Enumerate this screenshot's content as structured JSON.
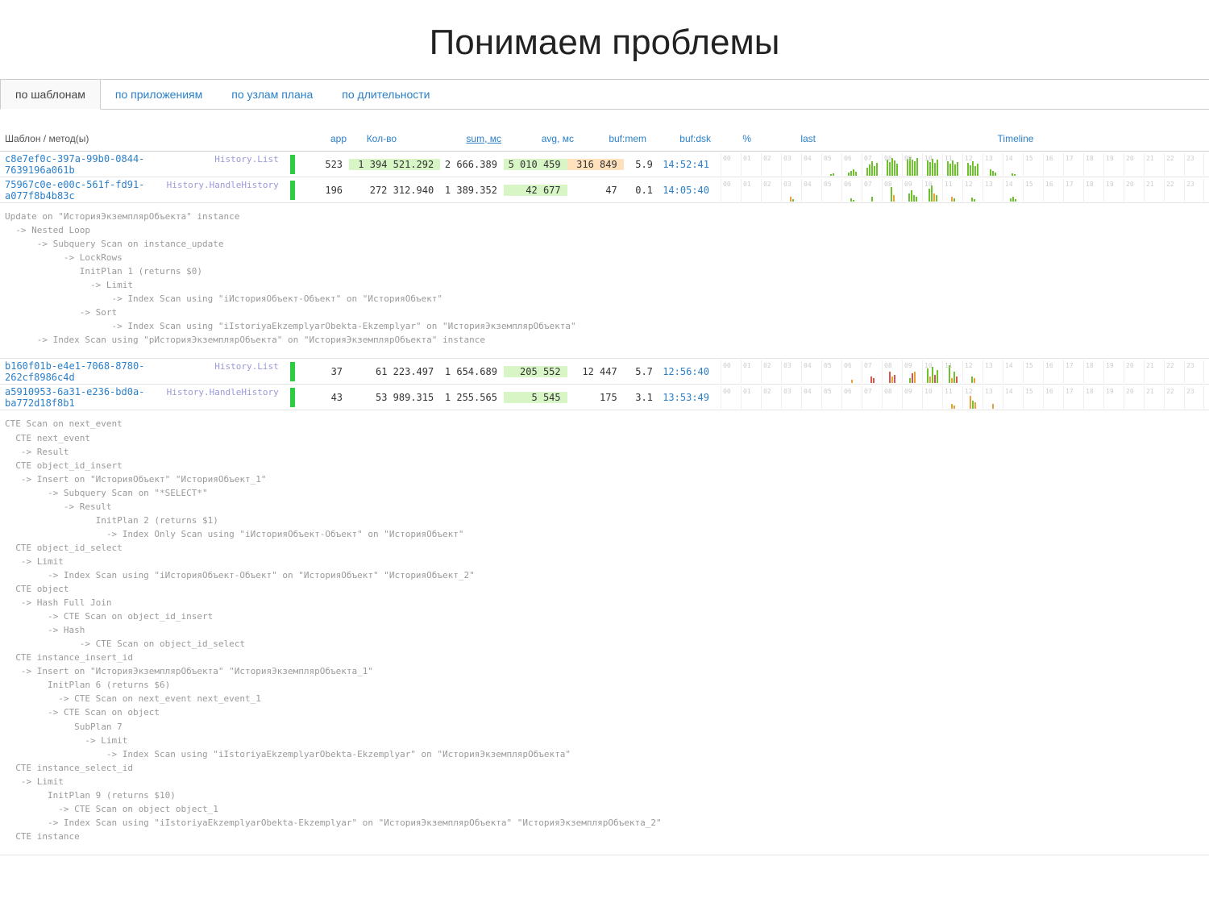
{
  "title": "Понимаем проблемы",
  "tabs": [
    "по шаблонам",
    "по приложениям",
    "по узлам плана",
    "по длительности"
  ],
  "active_tab": 0,
  "headers": {
    "template": "Шаблон / метод(ы)",
    "app": "app",
    "count": "Кол-во",
    "sum": "sum, мс",
    "avg": "avg, мс",
    "bufmem": "buf:mem",
    "bufdsk": "buf:dsk",
    "pct": "%",
    "last": "last",
    "timeline": "Timeline"
  },
  "rows": [
    {
      "hash": "c8e7ef0c-397a-99b0-0844-7639196a061b",
      "method": "History.List",
      "count": "523",
      "sum": "1 394 521.292",
      "avg": "2 666.389",
      "bufmem": "5 010 459",
      "bufdsk": "316 849",
      "pct": "5.9",
      "last": "14:52:41",
      "hl_sum": true,
      "hl_bufmem": true,
      "hl_bufdsk": true,
      "timeline": [
        [],
        [],
        [],
        [],
        [],
        [
          [
            "g",
            2
          ],
          [
            "g",
            3
          ]
        ],
        [
          [
            "g",
            4
          ],
          [
            "g",
            6
          ],
          [
            "g",
            8
          ],
          [
            "g",
            5
          ]
        ],
        [
          [
            "g",
            10
          ],
          [
            "g",
            14
          ],
          [
            "g",
            18
          ],
          [
            "g",
            12
          ],
          [
            "g",
            16
          ]
        ],
        [
          [
            "g",
            20
          ],
          [
            "g",
            17
          ],
          [
            "g",
            22
          ],
          [
            "g",
            19
          ],
          [
            "g",
            15
          ]
        ],
        [
          [
            "g",
            21
          ],
          [
            "g",
            23
          ],
          [
            "g",
            20
          ],
          [
            "g",
            18
          ],
          [
            "g",
            22
          ]
        ],
        [
          [
            "g",
            19
          ],
          [
            "g",
            17
          ],
          [
            "g",
            21
          ],
          [
            "g",
            16
          ],
          [
            "g",
            20
          ]
        ],
        [
          [
            "g",
            18
          ],
          [
            "g",
            15
          ],
          [
            "g",
            19
          ],
          [
            "g",
            14
          ],
          [
            "g",
            17
          ]
        ],
        [
          [
            "g",
            16
          ],
          [
            "g",
            13
          ],
          [
            "g",
            18
          ],
          [
            "g",
            12
          ],
          [
            "g",
            15
          ]
        ],
        [
          [
            "g",
            8
          ],
          [
            "g",
            6
          ],
          [
            "g",
            4
          ]
        ],
        [
          [
            "g",
            3
          ],
          [
            "g",
            2
          ]
        ],
        [],
        [],
        [],
        [],
        [],
        [],
        [],
        [],
        []
      ]
    },
    {
      "hash": "75967c0e-e00c-561f-fd91-a077f8b4b83c",
      "method": "History.HandleHistory",
      "count": "196",
      "sum": "272 312.940",
      "avg": "1 389.352",
      "bufmem": "42 677",
      "bufdsk": "47",
      "pct": "0.1",
      "last": "14:05:40",
      "hl_bufmem": true,
      "timeline": [
        [],
        [],
        [],
        [
          [
            "o",
            6
          ],
          [
            "g",
            3
          ]
        ],
        [],
        [],
        [
          [
            "g",
            4
          ],
          [
            "g",
            2
          ]
        ],
        [
          [
            "g",
            6
          ]
        ],
        [
          [
            "g",
            18
          ],
          [
            "o",
            8
          ]
        ],
        [
          [
            "g",
            10
          ],
          [
            "g",
            14
          ],
          [
            "g",
            8
          ],
          [
            "g",
            6
          ]
        ],
        [
          [
            "g",
            16
          ],
          [
            "g",
            20
          ],
          [
            "o",
            10
          ],
          [
            "g",
            8
          ]
        ],
        [
          [
            "o",
            6
          ],
          [
            "g",
            4
          ]
        ],
        [
          [
            "g",
            5
          ],
          [
            "g",
            3
          ]
        ],
        [],
        [
          [
            "g",
            4
          ],
          [
            "g",
            6
          ],
          [
            "g",
            3
          ]
        ],
        [],
        [],
        [],
        [],
        [],
        [],
        [],
        [],
        []
      ]
    },
    {
      "hash": "b160f01b-e4e1-7068-8780-262cf8986c4d",
      "method": "History.List",
      "count": "37",
      "sum": "61 223.497",
      "avg": "1 654.689",
      "bufmem": "205 552",
      "bufdsk": "12 447",
      "pct": "5.7",
      "last": "12:56:40",
      "hl_bufmem": true,
      "timeline": [
        [],
        [],
        [],
        [],
        [],
        [],
        [
          [
            "o",
            4
          ]
        ],
        [
          [
            "r",
            8
          ],
          [
            "r",
            6
          ]
        ],
        [
          [
            "r",
            14
          ],
          [
            "o",
            8
          ],
          [
            "r",
            10
          ]
        ],
        [
          [
            "g",
            6
          ],
          [
            "r",
            12
          ],
          [
            "o",
            14
          ]
        ],
        [
          [
            "g",
            18
          ],
          [
            "o",
            8
          ],
          [
            "g",
            20
          ],
          [
            "r",
            10
          ],
          [
            "g",
            16
          ]
        ],
        [
          [
            "g",
            22
          ],
          [
            "o",
            6
          ],
          [
            "g",
            14
          ],
          [
            "r",
            8
          ]
        ],
        [
          [
            "g",
            8
          ],
          [
            "o",
            6
          ]
        ],
        [],
        [],
        [],
        [],
        [],
        [],
        [],
        [],
        [],
        [],
        []
      ]
    },
    {
      "hash": "a5910953-6a31-e236-bd0a-ba772d18f8b1",
      "method": "History.HandleHistory",
      "count": "43",
      "sum": "53 989.315",
      "avg": "1 255.565",
      "bufmem": "5 545",
      "bufdsk": "175",
      "pct": "3.1",
      "last": "13:53:49",
      "hl_bufmem": true,
      "timeline": [
        [],
        [],
        [],
        [],
        [],
        [],
        [],
        [],
        [],
        [],
        [],
        [
          [
            "o",
            6
          ],
          [
            "o",
            4
          ]
        ],
        [
          [
            "o",
            16
          ],
          [
            "g",
            10
          ],
          [
            "o",
            8
          ]
        ],
        [
          [
            "o",
            6
          ]
        ],
        [],
        [],
        [],
        [],
        [],
        [],
        [],
        [],
        [],
        []
      ]
    }
  ],
  "plan1": "Update on \"ИсторияЭкземплярОбъекта\" instance\n  -> Nested Loop\n      -> Subquery Scan on instance_update\n           -> LockRows\n              InitPlan 1 (returns $0)\n                -> Limit\n                    -> Index Scan using \"iИсторияОбъект-Объект\" on \"ИсторияОбъект\"\n              -> Sort\n                    -> Index Scan using \"iIstoriyaEkzemplyarObekta-Ekzemplyar\" on \"ИсторияЭкземплярОбъекта\"\n      -> Index Scan using \"pИсторияЭкземплярОбъекта\" on \"ИсторияЭкземплярОбъекта\" instance",
  "plan2": "CTE Scan on next_event\n  CTE next_event\n   -> Result\n  CTE object_id_insert\n   -> Insert on \"ИсторияОбъект\" \"ИсторияОбъект_1\"\n        -> Subquery Scan on \"*SELECT*\"\n           -> Result\n                 InitPlan 2 (returns $1)\n                   -> Index Only Scan using \"iИсторияОбъект-Объект\" on \"ИсторияОбъект\"\n  CTE object_id_select\n   -> Limit\n        -> Index Scan using \"iИсторияОбъект-Объект\" on \"ИсторияОбъект\" \"ИсторияОбъект_2\"\n  CTE object\n   -> Hash Full Join\n        -> CTE Scan on object_id_insert\n        -> Hash\n              -> CTE Scan on object_id_select\n  CTE instance_insert_id\n   -> Insert on \"ИсторияЭкземплярОбъекта\" \"ИсторияЭкземплярОбъекта_1\"\n        InitPlan 6 (returns $6)\n          -> CTE Scan on next_event next_event_1\n        -> CTE Scan on object\n             SubPlan 7\n               -> Limit\n                   -> Index Scan using \"iIstoriyaEkzemplyarObekta-Ekzemplyar\" on \"ИсторияЭкземплярОбъекта\"\n  CTE instance_select_id\n   -> Limit\n        InitPlan 9 (returns $10)\n          -> CTE Scan on object object_1\n        -> Index Scan using \"iIstoriyaEkzemplyarObekta-Ekzemplyar\" on \"ИсторияЭкземплярОбъекта\" \"ИсторияЭкземплярОбъекта_2\"\n  CTE instance"
}
